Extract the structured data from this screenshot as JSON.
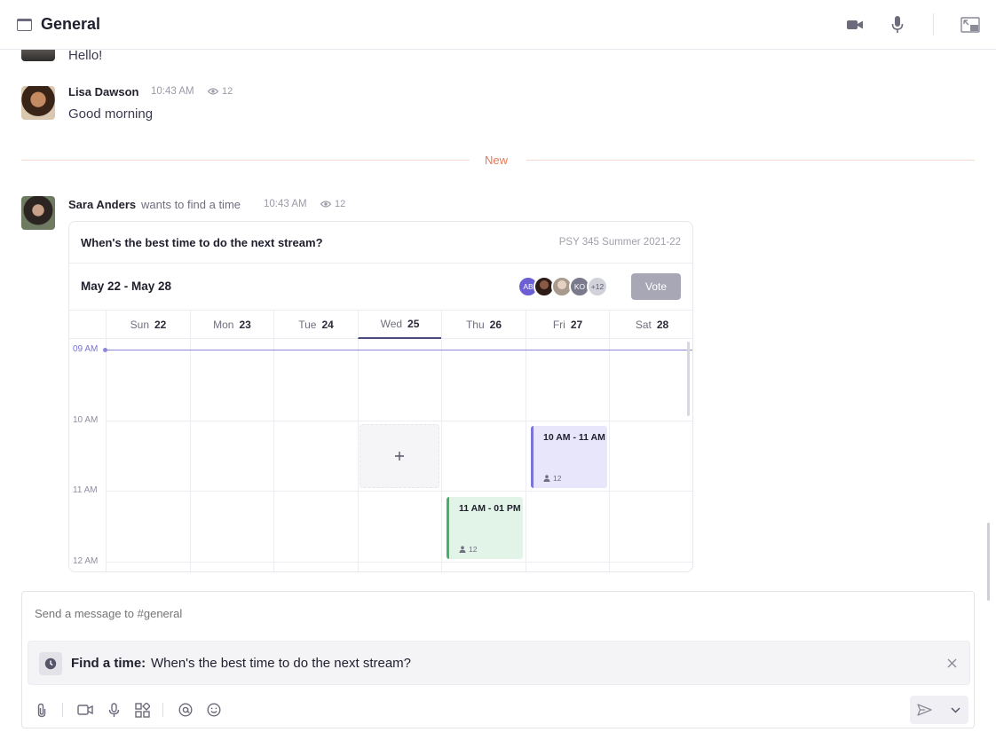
{
  "header": {
    "title": "General",
    "icons": [
      "window-icon",
      "video-camera-icon",
      "microphone-icon",
      "picture-in-picture-icon"
    ]
  },
  "messages": [
    {
      "text": "Hello!"
    },
    {
      "author": "Lisa Dawson",
      "time": "10:43 AM",
      "views": "12",
      "text": "Good morning"
    }
  ],
  "divider": {
    "label": "New"
  },
  "poll_message": {
    "author": "Sara Anders",
    "action": "wants to find a time",
    "time": "10:43 AM",
    "views": "12"
  },
  "poll_card": {
    "question": "When's the best time to do the next stream?",
    "course": "PSY 345 Summer 2021-22",
    "range": "May 22 - May 28",
    "avatars": [
      {
        "initials": "AB",
        "color": "#6c5fd3"
      },
      {
        "initials": "",
        "color": "#5a4038"
      },
      {
        "initials": "",
        "color": "#c9b8a8"
      },
      {
        "initials": "KO",
        "color": "#7a7a8c"
      },
      {
        "initials": "+12",
        "color": "#c6c6d0"
      }
    ],
    "vote_label": "Vote",
    "days": [
      {
        "name": "Sun",
        "num": "22"
      },
      {
        "name": "Mon",
        "num": "23"
      },
      {
        "name": "Tue",
        "num": "24"
      },
      {
        "name": "Wed",
        "num": "25"
      },
      {
        "name": "Thu",
        "num": "26"
      },
      {
        "name": "Fri",
        "num": "27"
      },
      {
        "name": "Sat",
        "num": "28"
      }
    ],
    "times": [
      "09 AM",
      "10 AM",
      "11 AM",
      "12 AM"
    ],
    "events": [
      {
        "label": "10 AM - 11 AM",
        "count": "12",
        "color": "#7d74da"
      },
      {
        "label": "11 AM - 01 PM",
        "count": "12",
        "color": "#43b36a"
      }
    ]
  },
  "composer": {
    "placeholder": "Send a message to #general",
    "find_label": "Find a time:",
    "find_text": "When's the best time to do the next stream?"
  }
}
